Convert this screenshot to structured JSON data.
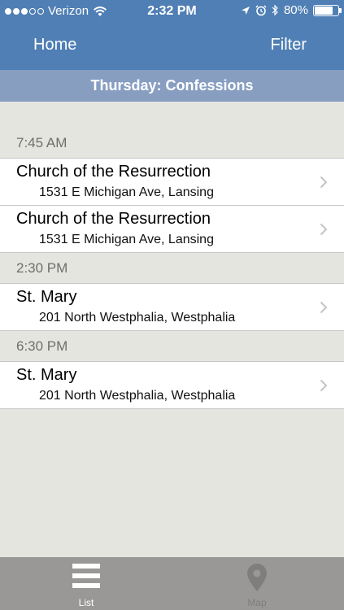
{
  "status_bar": {
    "carrier": "Verizon",
    "time": "2:32 PM",
    "battery": "80%",
    "battery_level": 0.8
  },
  "nav": {
    "left_label": "Home",
    "right_label": "Filter"
  },
  "subheader": {
    "title": "Thursday: Confessions"
  },
  "groups": [
    {
      "time": "7:45 AM",
      "items": [
        {
          "name": "Church of the Resurrection",
          "address": "1531 E Michigan Ave, Lansing"
        },
        {
          "name": "Church of the Resurrection",
          "address": "1531 E Michigan Ave, Lansing"
        }
      ]
    },
    {
      "time": "2:30 PM",
      "items": [
        {
          "name": "St. Mary",
          "address": "201 North Westphalia, Westphalia"
        }
      ]
    },
    {
      "time": "6:30 PM",
      "items": [
        {
          "name": "St. Mary",
          "address": "201 North Westphalia, Westphalia"
        }
      ]
    }
  ],
  "tabbar": {
    "list_label": "List",
    "map_label": "Map",
    "list_icon": "list-icon",
    "map_icon": "map-pin-icon"
  },
  "colors": {
    "nav_blue": "#4f7fb4",
    "subheader_blue": "#879ec1",
    "background": "#e5e5e0",
    "tabbar": "#999897"
  }
}
